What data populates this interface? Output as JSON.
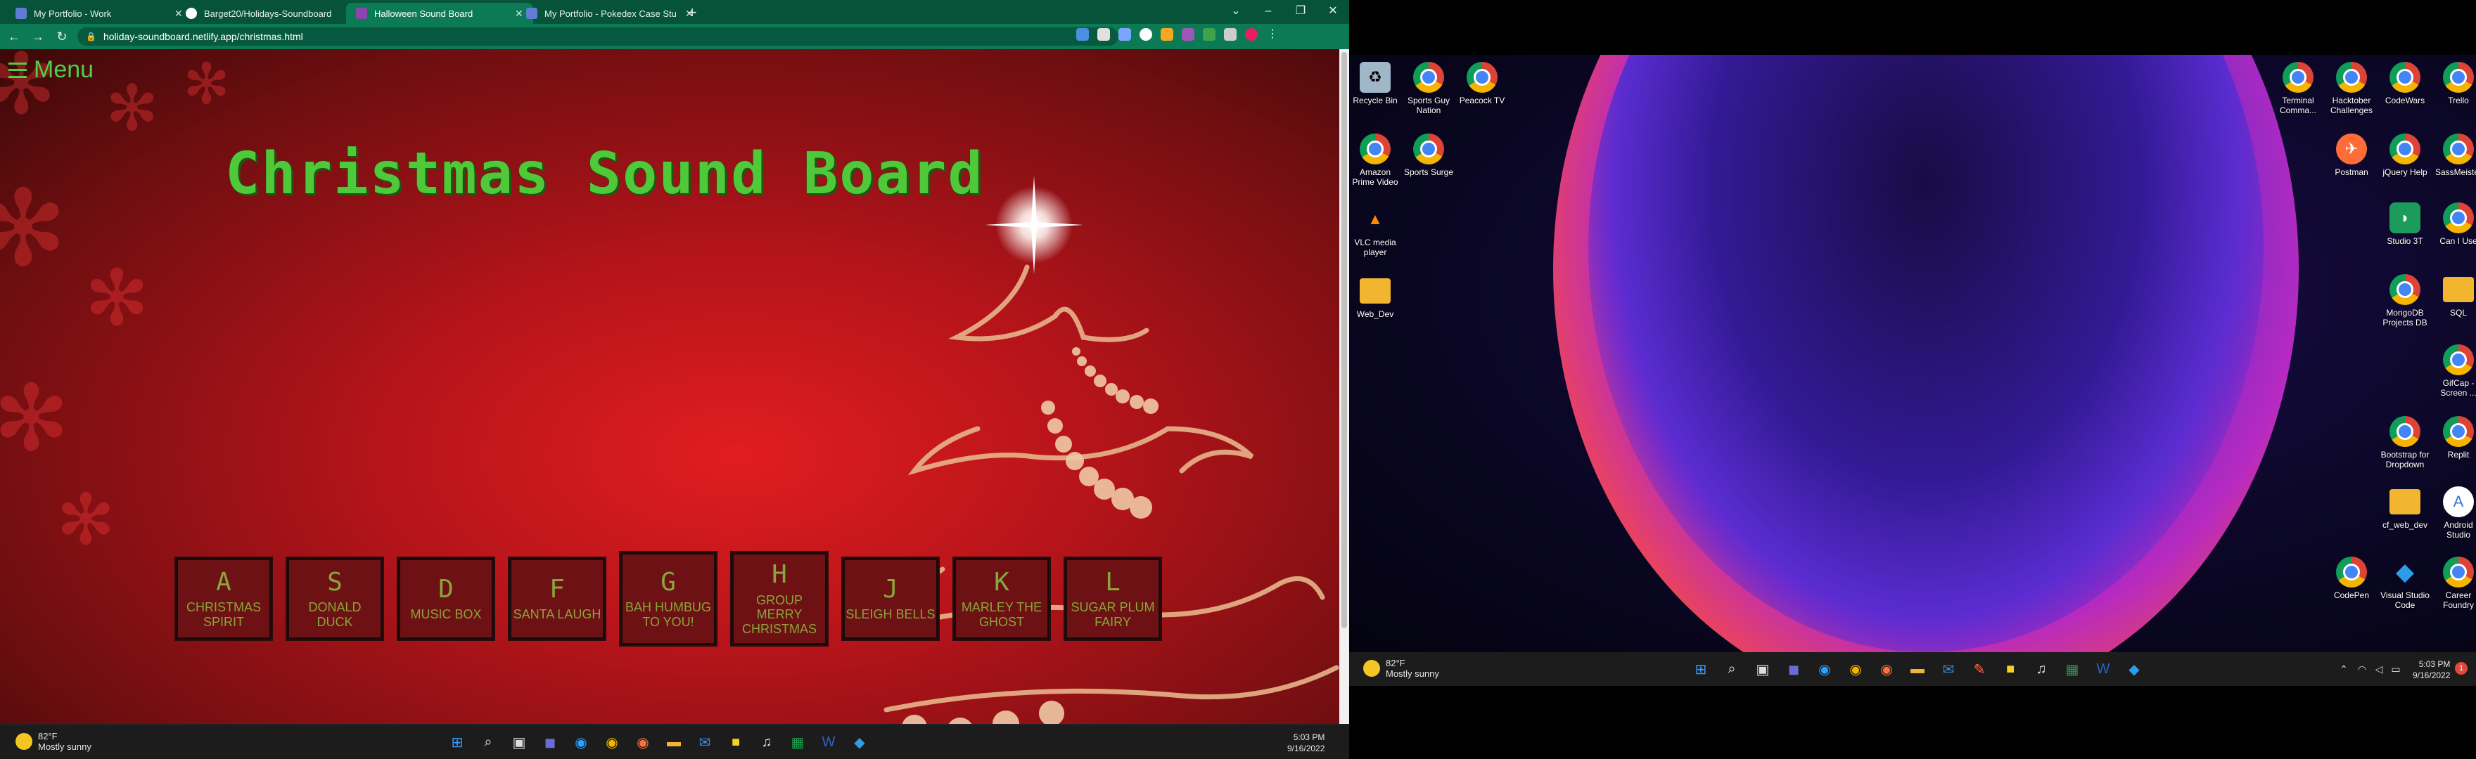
{
  "browser": {
    "tabs": [
      {
        "title": "My Portfolio - Work",
        "favicon_color": "#5f7dd6"
      },
      {
        "title": "Barget20/Holidays-Soundboard",
        "favicon_color": "#ffffff"
      },
      {
        "title": "Halloween Sound Board",
        "favicon_color": "#8e44ad"
      },
      {
        "title": "My Portfolio - Pokedex Case Stu",
        "favicon_color": "#5f7dd6"
      }
    ],
    "active_tab_index": 2,
    "url": "holiday-soundboard.netlify.app/christmas.html"
  },
  "page": {
    "menu_label": "Menu",
    "title": "Christmas Sound Board",
    "pads": [
      {
        "key": "A",
        "sound": "CHRISTMAS SPIRIT"
      },
      {
        "key": "S",
        "sound": "DONALD DUCK"
      },
      {
        "key": "D",
        "sound": "MUSIC BOX"
      },
      {
        "key": "F",
        "sound": "SANTA LAUGH"
      },
      {
        "key": "G",
        "sound": "BAH HUMBUG TO YOU!"
      },
      {
        "key": "H",
        "sound": "GROUP MERRY CHRISTMAS"
      },
      {
        "key": "J",
        "sound": "SLEIGH BELLS"
      },
      {
        "key": "K",
        "sound": "MARLEY THE GHOST"
      },
      {
        "key": "L",
        "sound": "SUGAR PLUM FAIRY"
      }
    ]
  },
  "taskbar_left": {
    "weather_temp": "82°F",
    "weather_desc": "Mostly sunny",
    "time": "5:03 PM",
    "date": "9/16/2022"
  },
  "taskbar_right": {
    "weather_temp": "82°F",
    "weather_desc": "Mostly sunny",
    "time": "5:03 PM",
    "date": "9/16/2022",
    "notification_count": "1"
  },
  "desktop": {
    "left_icons": [
      {
        "label": "Recycle Bin",
        "icon": "recycle-bin-icon"
      },
      {
        "label": "Sports Guy Nation",
        "icon": "chrome-icon"
      },
      {
        "label": "Peacock TV",
        "icon": "chrome-icon"
      },
      {
        "label": "Amazon Prime Video",
        "icon": "chrome-icon"
      },
      {
        "label": "Sports Surge",
        "icon": "chrome-icon"
      },
      {
        "label": "VLC media player",
        "icon": "vlc-icon"
      },
      {
        "label": "Web_Dev",
        "icon": "folder-icon"
      }
    ],
    "right_icons": [
      {
        "label": "Terminal Comma...",
        "icon": "chrome-icon"
      },
      {
        "label": "Hacktober Challenges",
        "icon": "chrome-icon"
      },
      {
        "label": "CodeWars",
        "icon": "chrome-icon"
      },
      {
        "label": "Trello",
        "icon": "chrome-icon"
      },
      {
        "label": "Postman",
        "icon": "postman-icon"
      },
      {
        "label": "jQuery Help",
        "icon": "chrome-icon"
      },
      {
        "label": "SassMeister",
        "icon": "chrome-icon"
      },
      {
        "label": "Studio 3T",
        "icon": "studio3t-icon"
      },
      {
        "label": "Can I Use",
        "icon": "chrome-icon"
      },
      {
        "label": "MongoDB Projects DB",
        "icon": "chrome-icon"
      },
      {
        "label": "SQL",
        "icon": "folder-icon"
      },
      {
        "label": "GifCap - Screen ...",
        "icon": "chrome-icon"
      },
      {
        "label": "Bootstrap for Dropdown",
        "icon": "chrome-icon"
      },
      {
        "label": "Replit",
        "icon": "chrome-icon"
      },
      {
        "label": "cf_web_dev",
        "icon": "folder-icon"
      },
      {
        "label": "Android Studio",
        "icon": "android-studio-icon"
      },
      {
        "label": "CodePen",
        "icon": "chrome-icon"
      },
      {
        "label": "Visual Studio Code",
        "icon": "vscode-icon"
      },
      {
        "label": "Career Foundry",
        "icon": "chrome-icon"
      }
    ]
  }
}
